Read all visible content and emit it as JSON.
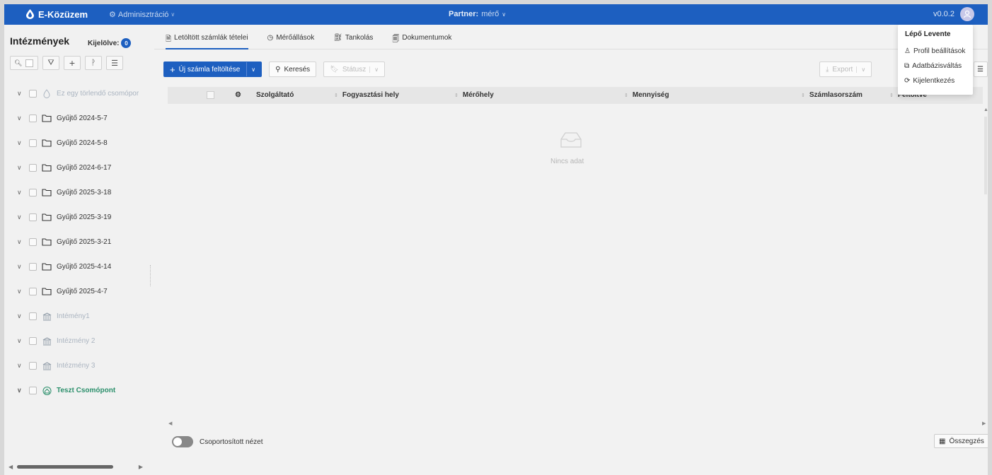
{
  "header": {
    "brand": "E-Közüzem",
    "admin_label": "Adminisztráció",
    "partner_label": "Partner:",
    "partner_value": "mérő",
    "version": "v0.0.2",
    "bg_color": "#1d5fc0"
  },
  "sidebar": {
    "title": "Intézmények",
    "selected_label": "Kijelölve:",
    "selected_count": "0",
    "items": [
      {
        "label": "Ez egy törlendő csomópor",
        "icon": "drop-outline-icon"
      },
      {
        "label": "Gyűjtő 2024-5-7",
        "icon": "folder-icon"
      },
      {
        "label": "Gyűjtő 2024-5-8",
        "icon": "folder-icon"
      },
      {
        "label": "Gyűjtő 2024-6-17",
        "icon": "folder-icon"
      },
      {
        "label": "Gyűjtő 2025-3-18",
        "icon": "folder-icon"
      },
      {
        "label": "Gyűjtő 2025-3-19",
        "icon": "folder-icon"
      },
      {
        "label": "Gyűjtő 2025-3-21",
        "icon": "folder-icon"
      },
      {
        "label": "Gyűjtő 2025-4-14",
        "icon": "folder-icon"
      },
      {
        "label": "Gyűjtő 2025-4-7",
        "icon": "folder-icon"
      },
      {
        "label": "Intémény1",
        "icon": "bank-icon"
      },
      {
        "label": "Intézmény 2",
        "icon": "bank-icon"
      },
      {
        "label": "Intézmény 3",
        "icon": "bank-icon"
      },
      {
        "label": "Teszt Csomópont",
        "icon": "home-icon"
      }
    ]
  },
  "tabs": [
    {
      "label": "Letöltött számlák tételei",
      "icon": "invoice-icon",
      "active": true
    },
    {
      "label": "Mérőállások",
      "icon": "gauge-icon",
      "active": false
    },
    {
      "label": "Tankolás",
      "icon": "fuel-icon",
      "active": false
    },
    {
      "label": "Dokumentumok",
      "icon": "document-icon",
      "active": false
    }
  ],
  "toolbar": {
    "upload_label": "Új számla feltöltése",
    "search_label": "Keresés",
    "status_label": "Státusz",
    "export_label": "Export"
  },
  "table": {
    "columns": [
      "Szolgáltató",
      "Fogyasztási hely",
      "Mérőhely",
      "Mennyiség",
      "Számlasorszám",
      "Feltöltve"
    ],
    "empty_text": "Nincs adat"
  },
  "footer": {
    "grouped_label": "Csoportosított nézet",
    "summary_label": "Összegzés"
  },
  "user_menu": {
    "name": "Lépő Levente",
    "items": [
      {
        "label": "Profil beállítások",
        "icon": "user-icon"
      },
      {
        "label": "Adatbázisváltás",
        "icon": "database-switch-icon"
      },
      {
        "label": "Kijelentkezés",
        "icon": "logout-icon"
      }
    ]
  }
}
